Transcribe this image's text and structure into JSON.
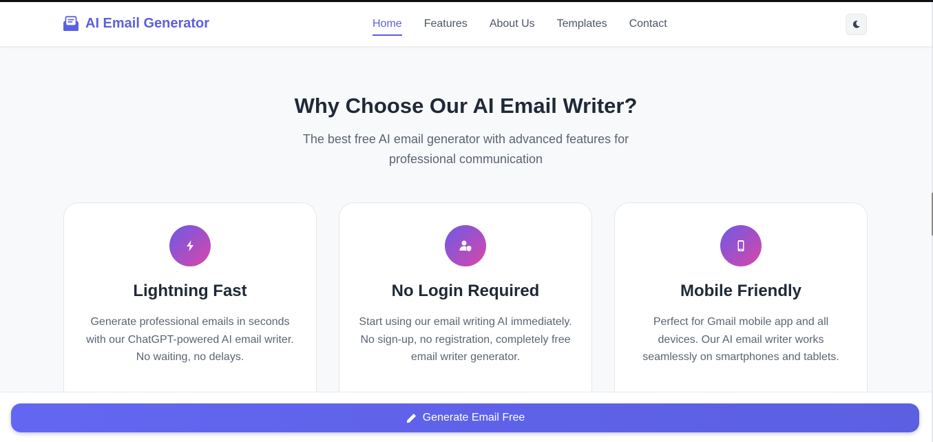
{
  "header": {
    "brand": "AI Email Generator",
    "nav": [
      "Home",
      "Features",
      "About Us",
      "Templates",
      "Contact"
    ],
    "active_nav": "Home",
    "theme_toggle_icon": "moon-icon"
  },
  "hero": {
    "title": "Why Choose Our AI Email Writer?",
    "subtitle": "The best free AI email generator with advanced features for professional communication"
  },
  "features": [
    {
      "icon": "lightning-bolt-icon",
      "title": "Lightning Fast",
      "description": "Generate professional emails in seconds with our ChatGPT-powered AI email writer. No waiting, no delays."
    },
    {
      "icon": "user-shield-icon",
      "title": "No Login Required",
      "description": "Start using our email writing AI immediately. No sign-up, no registration, completely free email writer generator."
    },
    {
      "icon": "mobile-phone-icon",
      "title": "Mobile Friendly",
      "description": "Perfect for Gmail mobile app and all devices. Our AI email writer works seamlessly on smartphones and tablets."
    }
  ],
  "cta": {
    "label": "Generate Email Free",
    "icon": "pencil-icon"
  },
  "colors": {
    "accent": "#5b5fe0",
    "gradient_start": "#6d5ae6",
    "gradient_end": "#d946a8",
    "text_dark": "#1f2937",
    "text_muted": "#5b6472"
  }
}
